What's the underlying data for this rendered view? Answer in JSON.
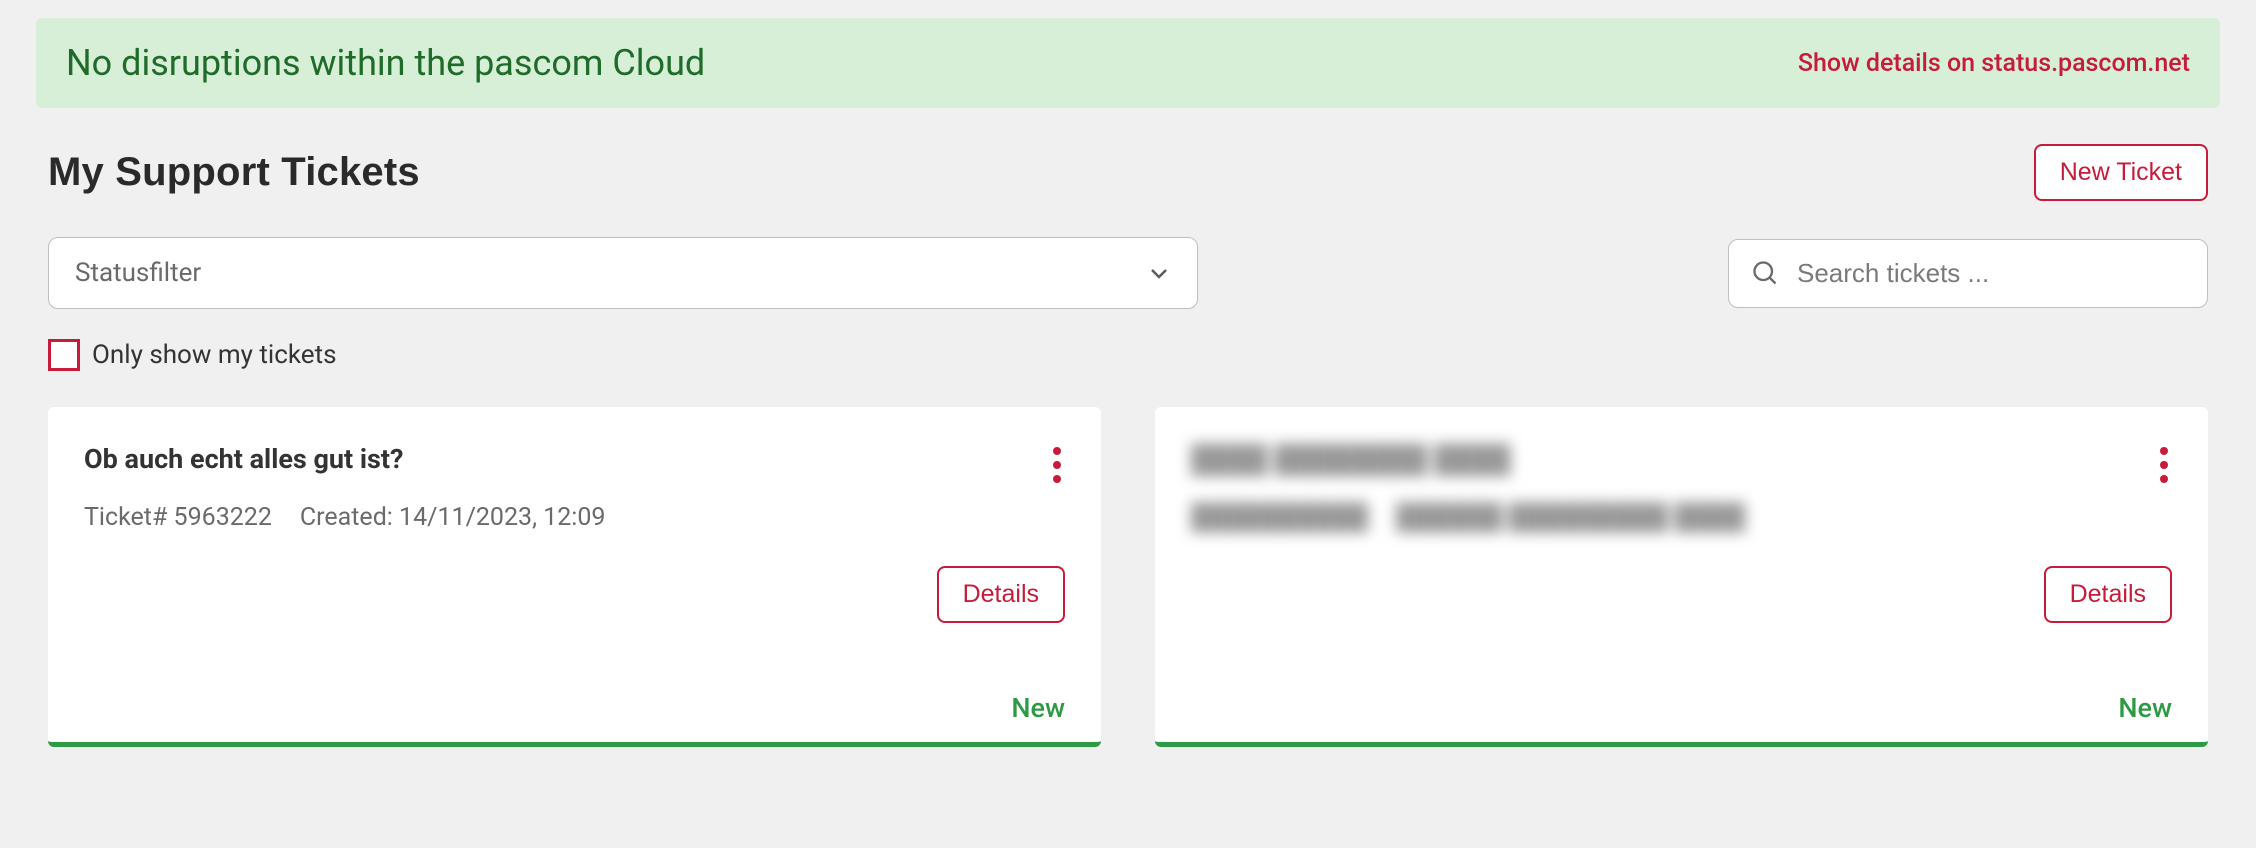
{
  "banner": {
    "message": "No disruptions within the pascom Cloud",
    "link": "Show details on status.pascom.net"
  },
  "header": {
    "title": "My Support Tickets",
    "new_ticket_label": "New Ticket"
  },
  "filters": {
    "status_placeholder": "Statusfilter",
    "search_placeholder": "Search tickets ...",
    "only_mine_label": "Only show my tickets"
  },
  "tickets": [
    {
      "title": "Ob auch echt alles gut ist?",
      "ticket_number_label": "Ticket# 5963222",
      "created_label": "Created: 14/11/2023, 12:09",
      "details_label": "Details",
      "status": "New"
    },
    {
      "title": "████ ████████ ████",
      "ticket_number_label": "██████████",
      "created_label": "██████ █████████ ████",
      "details_label": "Details",
      "status": "New"
    }
  ]
}
